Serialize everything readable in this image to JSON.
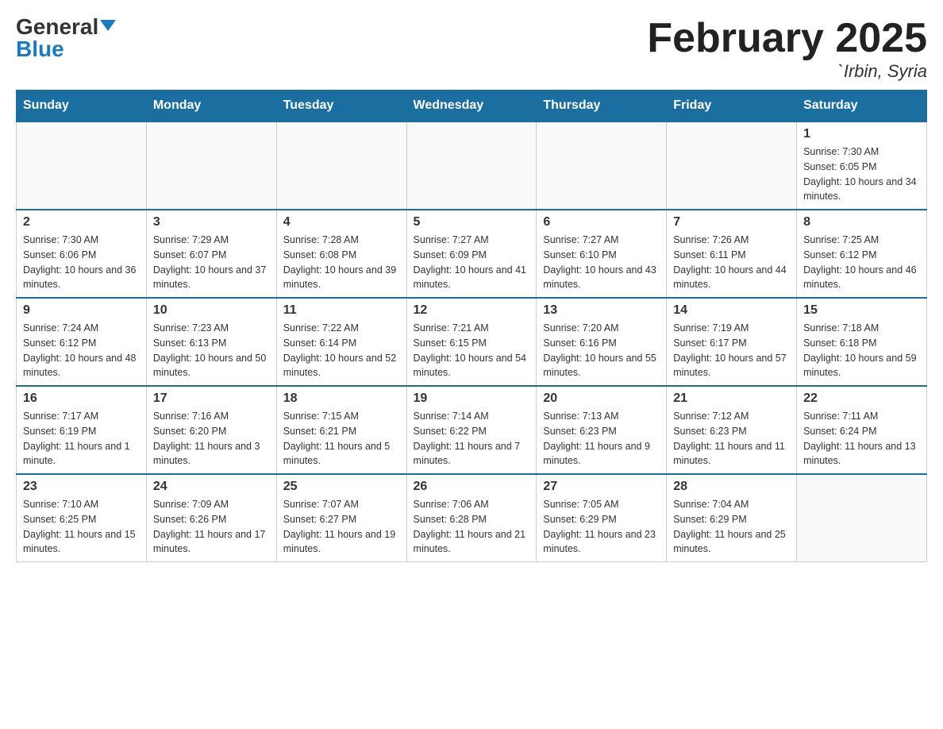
{
  "logo": {
    "general": "General",
    "blue": "Blue"
  },
  "title": "February 2025",
  "location": "`Irbin, Syria",
  "weekdays": [
    "Sunday",
    "Monday",
    "Tuesday",
    "Wednesday",
    "Thursday",
    "Friday",
    "Saturday"
  ],
  "weeks": [
    [
      {
        "day": "",
        "sunrise": "",
        "sunset": "",
        "daylight": ""
      },
      {
        "day": "",
        "sunrise": "",
        "sunset": "",
        "daylight": ""
      },
      {
        "day": "",
        "sunrise": "",
        "sunset": "",
        "daylight": ""
      },
      {
        "day": "",
        "sunrise": "",
        "sunset": "",
        "daylight": ""
      },
      {
        "day": "",
        "sunrise": "",
        "sunset": "",
        "daylight": ""
      },
      {
        "day": "",
        "sunrise": "",
        "sunset": "",
        "daylight": ""
      },
      {
        "day": "1",
        "sunrise": "Sunrise: 7:30 AM",
        "sunset": "Sunset: 6:05 PM",
        "daylight": "Daylight: 10 hours and 34 minutes."
      }
    ],
    [
      {
        "day": "2",
        "sunrise": "Sunrise: 7:30 AM",
        "sunset": "Sunset: 6:06 PM",
        "daylight": "Daylight: 10 hours and 36 minutes."
      },
      {
        "day": "3",
        "sunrise": "Sunrise: 7:29 AM",
        "sunset": "Sunset: 6:07 PM",
        "daylight": "Daylight: 10 hours and 37 minutes."
      },
      {
        "day": "4",
        "sunrise": "Sunrise: 7:28 AM",
        "sunset": "Sunset: 6:08 PM",
        "daylight": "Daylight: 10 hours and 39 minutes."
      },
      {
        "day": "5",
        "sunrise": "Sunrise: 7:27 AM",
        "sunset": "Sunset: 6:09 PM",
        "daylight": "Daylight: 10 hours and 41 minutes."
      },
      {
        "day": "6",
        "sunrise": "Sunrise: 7:27 AM",
        "sunset": "Sunset: 6:10 PM",
        "daylight": "Daylight: 10 hours and 43 minutes."
      },
      {
        "day": "7",
        "sunrise": "Sunrise: 7:26 AM",
        "sunset": "Sunset: 6:11 PM",
        "daylight": "Daylight: 10 hours and 44 minutes."
      },
      {
        "day": "8",
        "sunrise": "Sunrise: 7:25 AM",
        "sunset": "Sunset: 6:12 PM",
        "daylight": "Daylight: 10 hours and 46 minutes."
      }
    ],
    [
      {
        "day": "9",
        "sunrise": "Sunrise: 7:24 AM",
        "sunset": "Sunset: 6:12 PM",
        "daylight": "Daylight: 10 hours and 48 minutes."
      },
      {
        "day": "10",
        "sunrise": "Sunrise: 7:23 AM",
        "sunset": "Sunset: 6:13 PM",
        "daylight": "Daylight: 10 hours and 50 minutes."
      },
      {
        "day": "11",
        "sunrise": "Sunrise: 7:22 AM",
        "sunset": "Sunset: 6:14 PM",
        "daylight": "Daylight: 10 hours and 52 minutes."
      },
      {
        "day": "12",
        "sunrise": "Sunrise: 7:21 AM",
        "sunset": "Sunset: 6:15 PM",
        "daylight": "Daylight: 10 hours and 54 minutes."
      },
      {
        "day": "13",
        "sunrise": "Sunrise: 7:20 AM",
        "sunset": "Sunset: 6:16 PM",
        "daylight": "Daylight: 10 hours and 55 minutes."
      },
      {
        "day": "14",
        "sunrise": "Sunrise: 7:19 AM",
        "sunset": "Sunset: 6:17 PM",
        "daylight": "Daylight: 10 hours and 57 minutes."
      },
      {
        "day": "15",
        "sunrise": "Sunrise: 7:18 AM",
        "sunset": "Sunset: 6:18 PM",
        "daylight": "Daylight: 10 hours and 59 minutes."
      }
    ],
    [
      {
        "day": "16",
        "sunrise": "Sunrise: 7:17 AM",
        "sunset": "Sunset: 6:19 PM",
        "daylight": "Daylight: 11 hours and 1 minute."
      },
      {
        "day": "17",
        "sunrise": "Sunrise: 7:16 AM",
        "sunset": "Sunset: 6:20 PM",
        "daylight": "Daylight: 11 hours and 3 minutes."
      },
      {
        "day": "18",
        "sunrise": "Sunrise: 7:15 AM",
        "sunset": "Sunset: 6:21 PM",
        "daylight": "Daylight: 11 hours and 5 minutes."
      },
      {
        "day": "19",
        "sunrise": "Sunrise: 7:14 AM",
        "sunset": "Sunset: 6:22 PM",
        "daylight": "Daylight: 11 hours and 7 minutes."
      },
      {
        "day": "20",
        "sunrise": "Sunrise: 7:13 AM",
        "sunset": "Sunset: 6:23 PM",
        "daylight": "Daylight: 11 hours and 9 minutes."
      },
      {
        "day": "21",
        "sunrise": "Sunrise: 7:12 AM",
        "sunset": "Sunset: 6:23 PM",
        "daylight": "Daylight: 11 hours and 11 minutes."
      },
      {
        "day": "22",
        "sunrise": "Sunrise: 7:11 AM",
        "sunset": "Sunset: 6:24 PM",
        "daylight": "Daylight: 11 hours and 13 minutes."
      }
    ],
    [
      {
        "day": "23",
        "sunrise": "Sunrise: 7:10 AM",
        "sunset": "Sunset: 6:25 PM",
        "daylight": "Daylight: 11 hours and 15 minutes."
      },
      {
        "day": "24",
        "sunrise": "Sunrise: 7:09 AM",
        "sunset": "Sunset: 6:26 PM",
        "daylight": "Daylight: 11 hours and 17 minutes."
      },
      {
        "day": "25",
        "sunrise": "Sunrise: 7:07 AM",
        "sunset": "Sunset: 6:27 PM",
        "daylight": "Daylight: 11 hours and 19 minutes."
      },
      {
        "day": "26",
        "sunrise": "Sunrise: 7:06 AM",
        "sunset": "Sunset: 6:28 PM",
        "daylight": "Daylight: 11 hours and 21 minutes."
      },
      {
        "day": "27",
        "sunrise": "Sunrise: 7:05 AM",
        "sunset": "Sunset: 6:29 PM",
        "daylight": "Daylight: 11 hours and 23 minutes."
      },
      {
        "day": "28",
        "sunrise": "Sunrise: 7:04 AM",
        "sunset": "Sunset: 6:29 PM",
        "daylight": "Daylight: 11 hours and 25 minutes."
      },
      {
        "day": "",
        "sunrise": "",
        "sunset": "",
        "daylight": ""
      }
    ]
  ]
}
